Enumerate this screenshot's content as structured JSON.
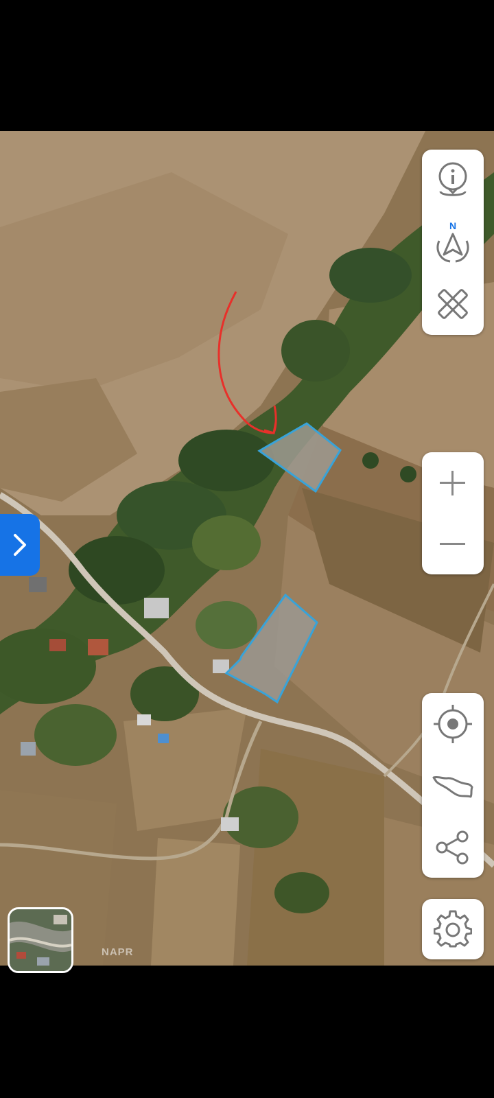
{
  "map": {
    "type": "satellite",
    "attribution": "NAPR",
    "parcel_outline_color": "#38a3d9",
    "annotation_color": "#e8302a"
  },
  "controls": {
    "top_group": [
      "info-icon",
      "compass-north-icon",
      "ruler-pencil-icon"
    ],
    "compass_label": "N",
    "zoom_group": [
      "zoom-in-icon",
      "zoom-out-icon"
    ],
    "location_group": [
      "locate-crosshair-icon",
      "country-outline-icon",
      "share-icon"
    ],
    "settings": "gear-icon",
    "side_panel_toggle": "chevron-right-icon",
    "accent": "#1673e6"
  },
  "layer_switcher": {
    "icon": "layer-thumbnail"
  }
}
